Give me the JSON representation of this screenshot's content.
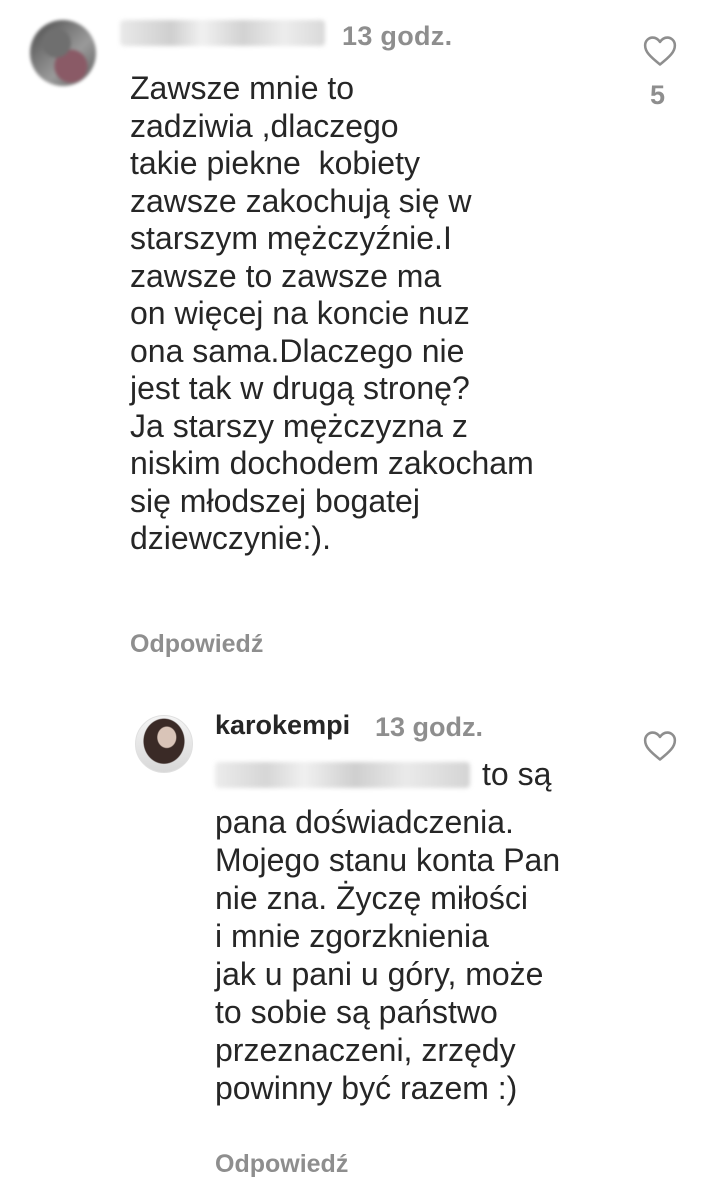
{
  "comments": [
    {
      "time": "13 godz.",
      "body": "Zawsze mnie to\nzadziwia ,dlaczego\ntakie piekne  kobiety\nzawsze zakochują się w\nstarszym mężczyźnie.I\nzawsze to zawsze ma\non więcej na koncie nuz\nona sama.Dlaczego nie\njest tak w drugą stronę?\nJa starszy mężczyzna z\nniskim dochodem zakocham\nsię młodszej bogatej\ndziewczynie:).",
      "reply_label": "Odpowiedź",
      "likes": "5",
      "like_icon": "heart-outline-icon"
    },
    {
      "username": "karokempi",
      "time": "13 godz.",
      "first_line": "to są",
      "body": "pana doświadczenia.\nMojego stanu konta Pan\nnie zna. Życzę miłości\ni mnie zgorzknienia\njak u pani u góry, może\nto sobie są państwo\nprzeznaczeni, zrzędy\npowinny być razem :)",
      "reply_label": "Odpowiedź",
      "like_icon": "heart-outline-icon"
    }
  ],
  "colors": {
    "text": "#262626",
    "secondary": "#8e8e8e",
    "background": "#ffffff"
  }
}
